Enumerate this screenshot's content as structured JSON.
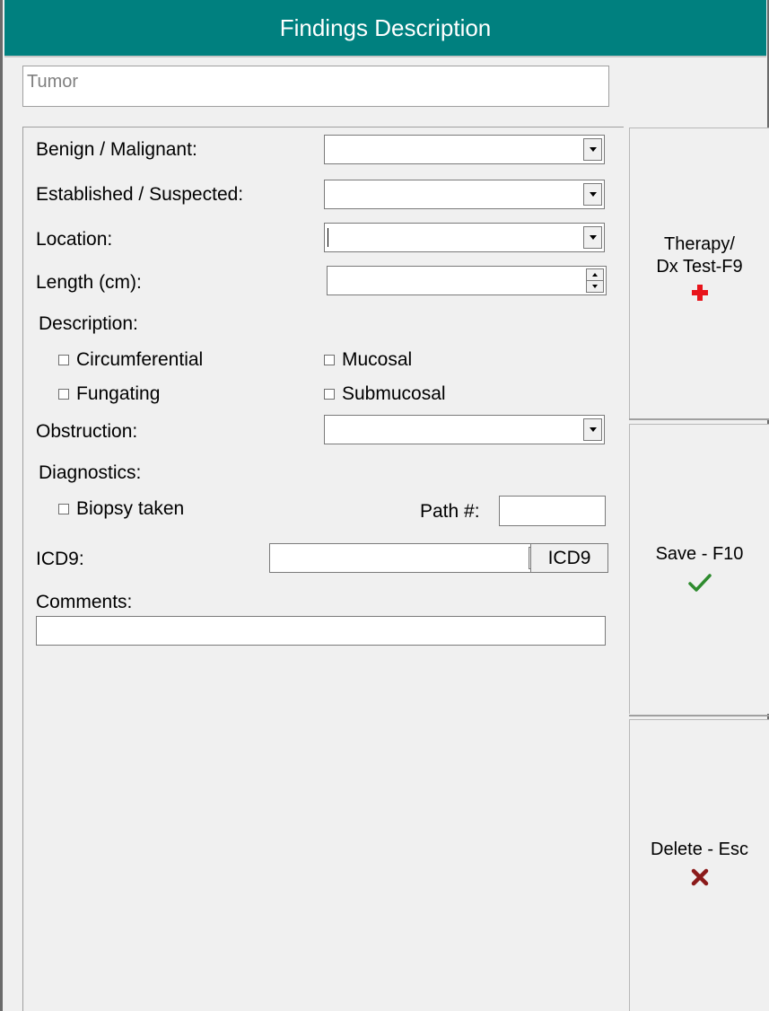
{
  "window": {
    "title": "Findings Description"
  },
  "finding_name": {
    "value": "Tumor"
  },
  "form": {
    "benign_malignant": {
      "label": "Benign / Malignant:",
      "value": ""
    },
    "established_suspected": {
      "label": "Established / Suspected:",
      "value": ""
    },
    "location": {
      "label": "Location:",
      "value": ""
    },
    "length": {
      "label": "Length (cm):",
      "value": ""
    },
    "description": {
      "label": "Description:",
      "options": [
        {
          "label": "Circumferential",
          "checked": false
        },
        {
          "label": "Mucosal",
          "checked": false
        },
        {
          "label": "Fungating",
          "checked": false
        },
        {
          "label": "Submucosal",
          "checked": false
        }
      ]
    },
    "obstruction": {
      "label": "Obstruction:",
      "value": ""
    },
    "diagnostics": {
      "label": "Diagnostics:",
      "biopsy": {
        "label": "Biopsy taken",
        "checked": false
      },
      "path": {
        "label": "Path #:",
        "value": ""
      }
    },
    "icd9": {
      "label": "ICD9:",
      "value": "",
      "button_label": "ICD9"
    },
    "comments": {
      "label": "Comments:",
      "value": ""
    }
  },
  "actions": {
    "therapy": {
      "line1": "Therapy/",
      "line2": "Dx Test-F9",
      "icon": "plus-icon",
      "icon_color": "#e8141b"
    },
    "save": {
      "label": "Save - F10",
      "icon": "checkmark-icon",
      "icon_color": "#2e8b2e"
    },
    "delete": {
      "label": "Delete - Esc",
      "icon": "x-icon",
      "icon_color": "#8b1a1a"
    }
  },
  "colors": {
    "title_bar": "#00807f",
    "title_text": "#ffffff",
    "background": "#f0f0f0"
  }
}
